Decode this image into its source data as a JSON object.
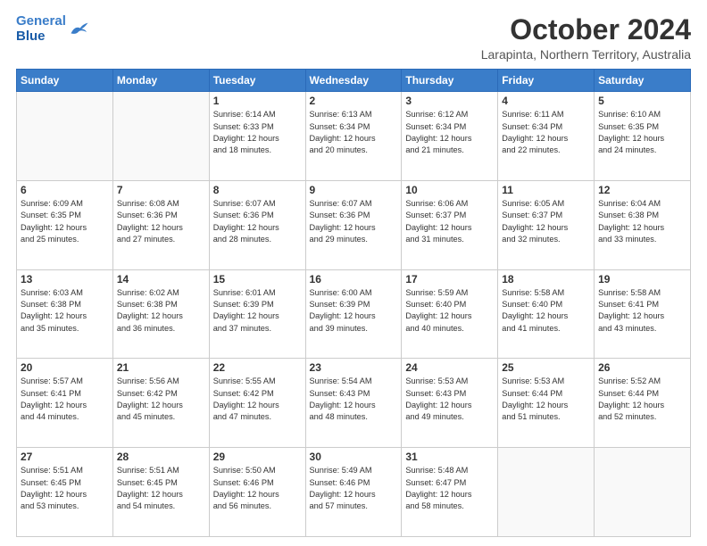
{
  "header": {
    "logo_line1": "General",
    "logo_line2": "Blue",
    "month": "October 2024",
    "location": "Larapinta, Northern Territory, Australia"
  },
  "weekdays": [
    "Sunday",
    "Monday",
    "Tuesday",
    "Wednesday",
    "Thursday",
    "Friday",
    "Saturday"
  ],
  "weeks": [
    [
      {
        "day": "",
        "text": ""
      },
      {
        "day": "",
        "text": ""
      },
      {
        "day": "1",
        "text": "Sunrise: 6:14 AM\nSunset: 6:33 PM\nDaylight: 12 hours\nand 18 minutes."
      },
      {
        "day": "2",
        "text": "Sunrise: 6:13 AM\nSunset: 6:34 PM\nDaylight: 12 hours\nand 20 minutes."
      },
      {
        "day": "3",
        "text": "Sunrise: 6:12 AM\nSunset: 6:34 PM\nDaylight: 12 hours\nand 21 minutes."
      },
      {
        "day": "4",
        "text": "Sunrise: 6:11 AM\nSunset: 6:34 PM\nDaylight: 12 hours\nand 22 minutes."
      },
      {
        "day": "5",
        "text": "Sunrise: 6:10 AM\nSunset: 6:35 PM\nDaylight: 12 hours\nand 24 minutes."
      }
    ],
    [
      {
        "day": "6",
        "text": "Sunrise: 6:09 AM\nSunset: 6:35 PM\nDaylight: 12 hours\nand 25 minutes."
      },
      {
        "day": "7",
        "text": "Sunrise: 6:08 AM\nSunset: 6:36 PM\nDaylight: 12 hours\nand 27 minutes."
      },
      {
        "day": "8",
        "text": "Sunrise: 6:07 AM\nSunset: 6:36 PM\nDaylight: 12 hours\nand 28 minutes."
      },
      {
        "day": "9",
        "text": "Sunrise: 6:07 AM\nSunset: 6:36 PM\nDaylight: 12 hours\nand 29 minutes."
      },
      {
        "day": "10",
        "text": "Sunrise: 6:06 AM\nSunset: 6:37 PM\nDaylight: 12 hours\nand 31 minutes."
      },
      {
        "day": "11",
        "text": "Sunrise: 6:05 AM\nSunset: 6:37 PM\nDaylight: 12 hours\nand 32 minutes."
      },
      {
        "day": "12",
        "text": "Sunrise: 6:04 AM\nSunset: 6:38 PM\nDaylight: 12 hours\nand 33 minutes."
      }
    ],
    [
      {
        "day": "13",
        "text": "Sunrise: 6:03 AM\nSunset: 6:38 PM\nDaylight: 12 hours\nand 35 minutes."
      },
      {
        "day": "14",
        "text": "Sunrise: 6:02 AM\nSunset: 6:38 PM\nDaylight: 12 hours\nand 36 minutes."
      },
      {
        "day": "15",
        "text": "Sunrise: 6:01 AM\nSunset: 6:39 PM\nDaylight: 12 hours\nand 37 minutes."
      },
      {
        "day": "16",
        "text": "Sunrise: 6:00 AM\nSunset: 6:39 PM\nDaylight: 12 hours\nand 39 minutes."
      },
      {
        "day": "17",
        "text": "Sunrise: 5:59 AM\nSunset: 6:40 PM\nDaylight: 12 hours\nand 40 minutes."
      },
      {
        "day": "18",
        "text": "Sunrise: 5:58 AM\nSunset: 6:40 PM\nDaylight: 12 hours\nand 41 minutes."
      },
      {
        "day": "19",
        "text": "Sunrise: 5:58 AM\nSunset: 6:41 PM\nDaylight: 12 hours\nand 43 minutes."
      }
    ],
    [
      {
        "day": "20",
        "text": "Sunrise: 5:57 AM\nSunset: 6:41 PM\nDaylight: 12 hours\nand 44 minutes."
      },
      {
        "day": "21",
        "text": "Sunrise: 5:56 AM\nSunset: 6:42 PM\nDaylight: 12 hours\nand 45 minutes."
      },
      {
        "day": "22",
        "text": "Sunrise: 5:55 AM\nSunset: 6:42 PM\nDaylight: 12 hours\nand 47 minutes."
      },
      {
        "day": "23",
        "text": "Sunrise: 5:54 AM\nSunset: 6:43 PM\nDaylight: 12 hours\nand 48 minutes."
      },
      {
        "day": "24",
        "text": "Sunrise: 5:53 AM\nSunset: 6:43 PM\nDaylight: 12 hours\nand 49 minutes."
      },
      {
        "day": "25",
        "text": "Sunrise: 5:53 AM\nSunset: 6:44 PM\nDaylight: 12 hours\nand 51 minutes."
      },
      {
        "day": "26",
        "text": "Sunrise: 5:52 AM\nSunset: 6:44 PM\nDaylight: 12 hours\nand 52 minutes."
      }
    ],
    [
      {
        "day": "27",
        "text": "Sunrise: 5:51 AM\nSunset: 6:45 PM\nDaylight: 12 hours\nand 53 minutes."
      },
      {
        "day": "28",
        "text": "Sunrise: 5:51 AM\nSunset: 6:45 PM\nDaylight: 12 hours\nand 54 minutes."
      },
      {
        "day": "29",
        "text": "Sunrise: 5:50 AM\nSunset: 6:46 PM\nDaylight: 12 hours\nand 56 minutes."
      },
      {
        "day": "30",
        "text": "Sunrise: 5:49 AM\nSunset: 6:46 PM\nDaylight: 12 hours\nand 57 minutes."
      },
      {
        "day": "31",
        "text": "Sunrise: 5:48 AM\nSunset: 6:47 PM\nDaylight: 12 hours\nand 58 minutes."
      },
      {
        "day": "",
        "text": ""
      },
      {
        "day": "",
        "text": ""
      }
    ]
  ]
}
